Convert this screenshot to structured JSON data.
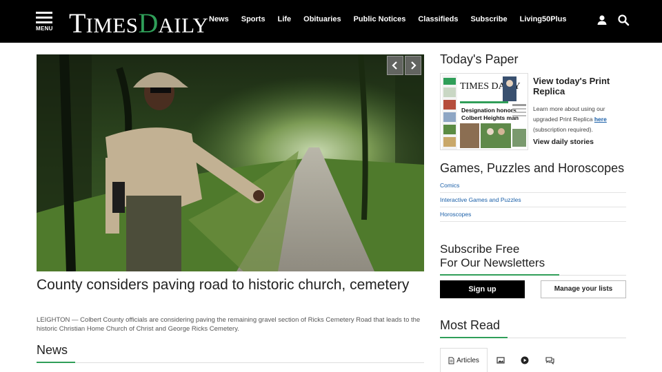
{
  "header": {
    "menu_label": "MENU",
    "logo_part1": "T",
    "logo_part2": "IMES",
    "logo_part3": "D",
    "logo_part4": "AILY",
    "nav": [
      "News",
      "Sports",
      "Life",
      "Obituaries",
      "Public Notices",
      "Classifieds",
      "Subscribe",
      "Living50Plus"
    ]
  },
  "main": {
    "headline": "County considers paving road to historic church, cemetery",
    "summary": "LEIGHTON — Colbert County officials are considering paving the remaining gravel section of Ricks Cemetery Road that leads to the historic Christian Home Church of Christ and George Ricks Cemetery.",
    "section_title": "News"
  },
  "rail": {
    "todays_paper": "Today's Paper",
    "print_title": "View today's Print Replica",
    "print_desc_before": "Learn more about using our upgraded Print Replica ",
    "print_desc_link": "here",
    "print_desc_after": " (subscription required).",
    "daily_stories": "View daily stories",
    "paper_thumb": {
      "masthead": "TIMES DAILY",
      "headline": "Designation honors Colbert Heights man"
    },
    "games_title": "Games, Puzzles and Horoscopes",
    "games_links": [
      "Comics",
      "Interactive Games and Puzzles",
      "Horoscopes"
    ],
    "subscribe_line1": "Subscribe Free",
    "subscribe_line2": "For Our Newsletters",
    "signup": "Sign up",
    "manage": "Manage your lists",
    "most_read": "Most Read",
    "tab_articles": "Articles"
  },
  "colors": {
    "brand_green": "#2f9e58",
    "link_blue": "#1a5fa8",
    "topbar": "#000000"
  }
}
